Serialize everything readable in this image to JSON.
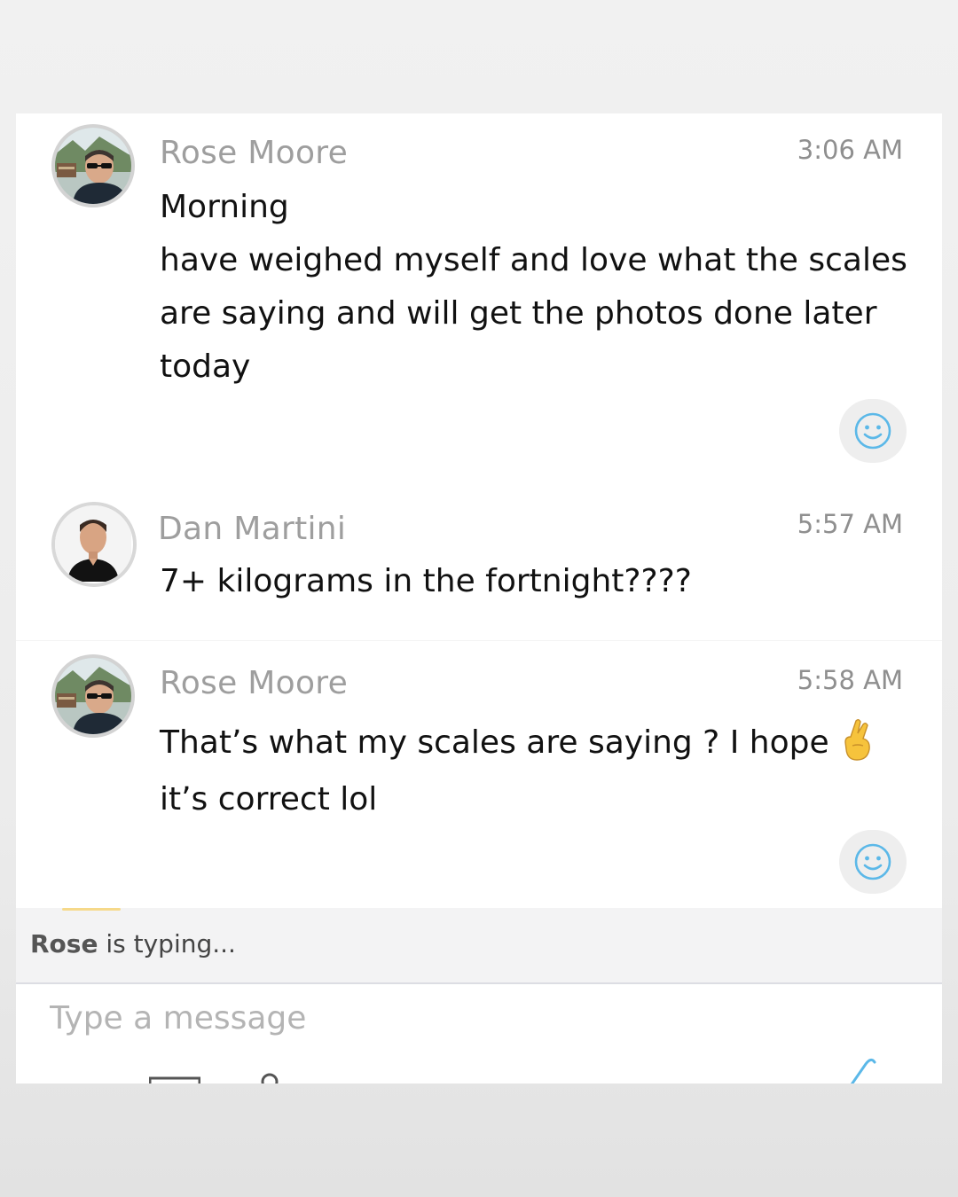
{
  "colors": {
    "accent": "#5bb8e8",
    "sender_text": "#9e9e9e",
    "body_text": "#111111",
    "reaction_bg": "#eeeeee",
    "typing_bar_bg": "#f3f3f4"
  },
  "messages": [
    {
      "sender": "Rose Moore",
      "time": "3:06 AM",
      "avatar_icon": "profile-photo-man-sunglasses",
      "lines": [
        "Morning",
        "have weighed myself and love what the scales are saying and will get the photos done later today"
      ],
      "reaction_icon": "smiley-face-icon"
    },
    {
      "sender": "Dan Martini",
      "time": "5:57 AM",
      "avatar_icon": "profile-photo-man-black-shirt",
      "lines": [
        "7+ kilograms in the fortnight????"
      ]
    },
    {
      "sender": "Rose Moore",
      "time": "5:58 AM",
      "avatar_icon": "profile-photo-man-sunglasses",
      "text": "That’s what my scales are saying ? I hope",
      "text_end": "it’s correct lol",
      "emoji": "crossed-fingers-emoji",
      "reaction_icon": "smiley-face-icon"
    }
  ],
  "typing": {
    "name": "Rose",
    "text": " is typing..."
  },
  "composer": {
    "placeholder": "Type a message",
    "icons": [
      "image-icon",
      "emoji-icon",
      "attachment-icon"
    ]
  }
}
